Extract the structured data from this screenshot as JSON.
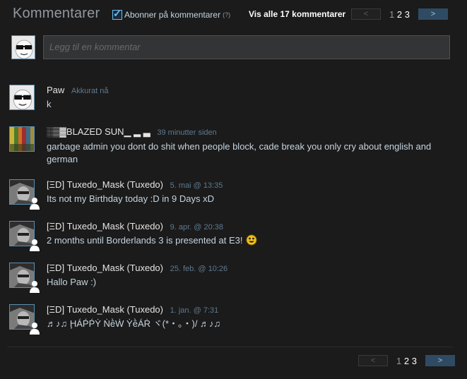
{
  "header": {
    "title": "Kommentarer",
    "subscribe_label": "Abonner på kommentarer",
    "help_mark": "(?)",
    "view_all": "Vis alle 17 kommentarer"
  },
  "pager": {
    "prev": "<",
    "next": ">",
    "pages": [
      "1",
      "2",
      "3"
    ],
    "current": "1"
  },
  "new_comment": {
    "placeholder": "Legg til en kommentar"
  },
  "comments": [
    {
      "author": "Paw",
      "time": "Akkurat nå",
      "text": "k"
    },
    {
      "author": "░▒▓BLAZED SUN▁ ▂ ▃",
      "time": "39 minutter siden",
      "text": "garbage admin you dont do shit when people block, cade break you only cry about english and german"
    },
    {
      "author": "[ΞD] Tuxedo_Mask (Tuxedo)",
      "time": "5. mai @ 13:35",
      "text": "Its not my Birthday today :D in 9 Days xD"
    },
    {
      "author": "[ΞD] Tuxedo_Mask (Tuxedo)",
      "time": "9. apr. @ 20:38",
      "text": "2 months until Borderlands 3 is presented at E3!"
    },
    {
      "author": "[ΞD] Tuxedo_Mask (Tuxedo)",
      "time": "25. feb. @ 10:26",
      "text": "Hallo Paw :)"
    },
    {
      "author": "[ΞD] Tuxedo_Mask (Tuxedo)",
      "time": "1. jan. @ 7:31",
      "text": "♬♪♫ ḨÁṔṔẎ ṄḕẆ ẎḕÁṘ ヾ(*・。・)/ ♬♪♫"
    }
  ],
  "colors": {
    "accent": "#67c1f5",
    "next_button": "#2f4b64",
    "background": "#1b1b1b"
  }
}
